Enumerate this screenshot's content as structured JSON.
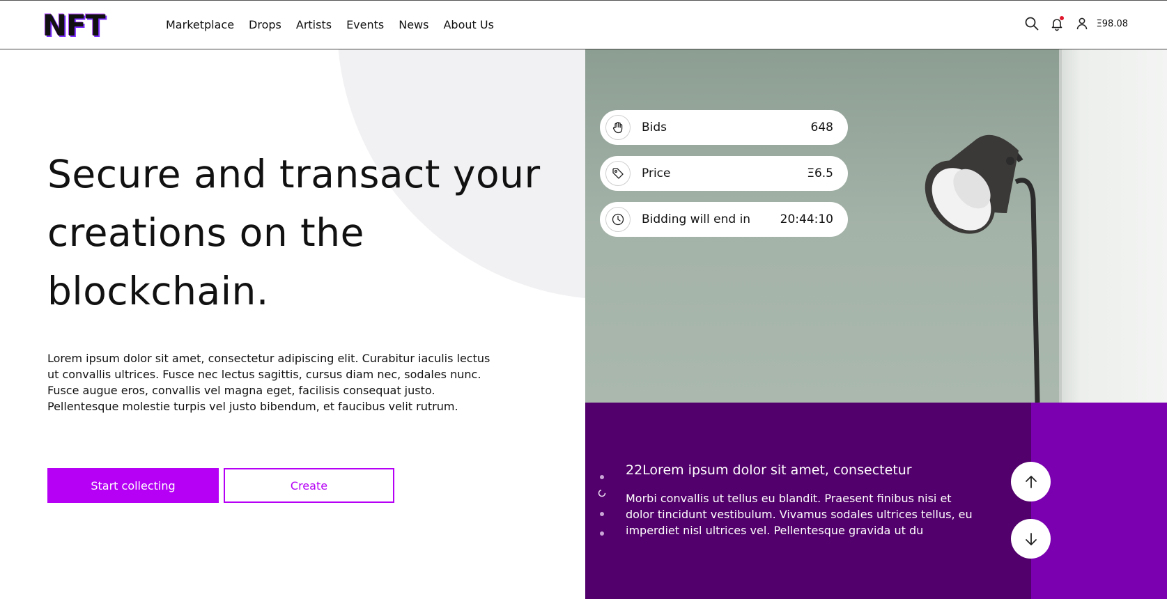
{
  "brand": {
    "logo": "NFT"
  },
  "nav": {
    "items": [
      "Marketplace",
      "Drops",
      "Artists",
      "Events",
      "News",
      "About Us"
    ]
  },
  "header": {
    "balance": "Ξ98.08",
    "icons": [
      "search-icon",
      "bell-icon",
      "user-icon"
    ]
  },
  "hero": {
    "title": "Secure and transact your creations on the blockchain.",
    "description": "Lorem ipsum dolor sit amet, consectetur adipiscing elit. Curabitur iaculis lectus ut convallis ultrices. Fusce nec lectus sagittis, cursus diam nec, sodales nunc. Fusce augue eros, convallis vel magna eget, facilisis consequat justo. Pellentesque molestie turpis vel justo bibendum, et faucibus velit rutrum.",
    "primary_button": "Start collecting",
    "secondary_button": "Create"
  },
  "stats": [
    {
      "icon": "hand-icon",
      "label": "Bids",
      "value": "648"
    },
    {
      "icon": "tag-icon",
      "label": "Price",
      "value": "Ξ6.5"
    },
    {
      "icon": "clock-icon",
      "label": "Bidding will end in",
      "value": "20:44:10"
    }
  ],
  "slider": {
    "title": "22Lorem ipsum dolor sit amet, consectetur",
    "text": "Morbi convallis ut tellus eu blandit. Praesent finibus nisi et dolor tincidunt vestibulum. Vivamus sodales ultrices tellus, eu imperdiet nisl ultrices vel. Pellentesque gravida ut du",
    "up_icon": "arrow-up-icon",
    "down_icon": "arrow-down-icon"
  },
  "colors": {
    "accent": "#b500f5",
    "panel_dark": "#52006b",
    "panel_light": "#7a00b0",
    "notification_dot": "#e0182d"
  }
}
